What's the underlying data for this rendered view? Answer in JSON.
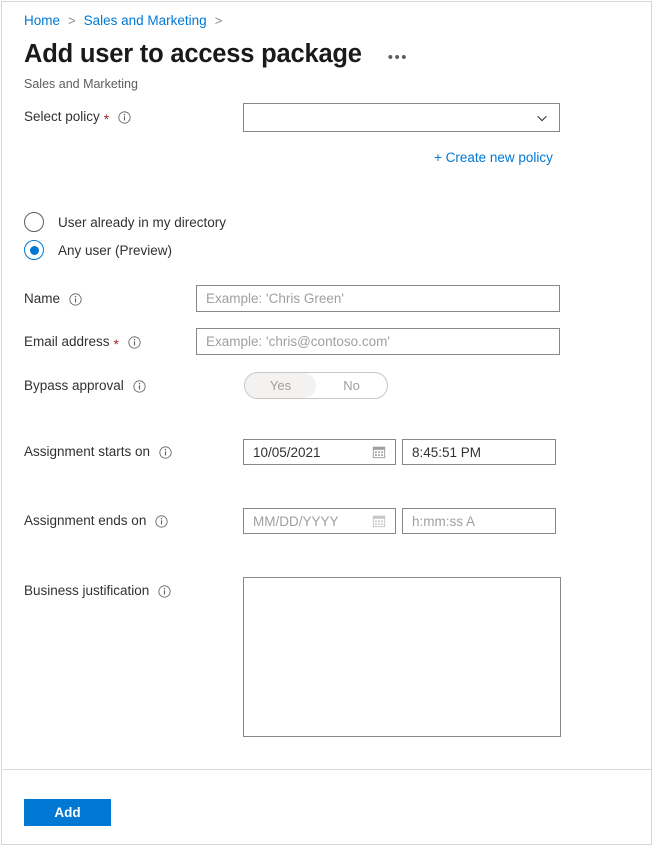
{
  "breadcrumb": {
    "items": [
      {
        "label": "Home"
      },
      {
        "label": "Sales and Marketing"
      }
    ],
    "separator": ">"
  },
  "header": {
    "title": "Add user to access package",
    "subtitle": "Sales and Marketing",
    "more_menu": "•••"
  },
  "form": {
    "policy": {
      "label": "Select policy",
      "required_marker": "*",
      "value": "",
      "create_link": "+ Create new policy"
    },
    "user_type": {
      "options": [
        {
          "label": "User already in my directory",
          "selected": false
        },
        {
          "label": "Any user (Preview)",
          "selected": true
        }
      ]
    },
    "name": {
      "label": "Name",
      "value": "",
      "placeholder": "Example: 'Chris Green'"
    },
    "email": {
      "label": "Email address",
      "required_marker": "*",
      "value": "",
      "placeholder": "Example: 'chris@contoso.com'"
    },
    "bypass_approval": {
      "label": "Bypass approval",
      "yes_label": "Yes",
      "no_label": "No",
      "selected": "Yes"
    },
    "assignment_starts": {
      "label": "Assignment starts on",
      "date_value": "10/05/2021",
      "date_placeholder": "MM/DD/YYYY",
      "time_value": "8:45:51 PM",
      "time_placeholder": "h:mm:ss A"
    },
    "assignment_ends": {
      "label": "Assignment ends on",
      "date_value": "",
      "date_placeholder": "MM/DD/YYYY",
      "time_value": "",
      "time_placeholder": "h:mm:ss A"
    },
    "business_justification": {
      "label": "Business justification",
      "value": ""
    }
  },
  "footer": {
    "add_label": "Add"
  },
  "colors": {
    "accent": "#0078d4",
    "link": "#0078d4",
    "required": "#a4262c",
    "border": "#8a8886",
    "panel_border": "#d6d6d6",
    "text": "#323130",
    "placeholder": "#a19f9d"
  }
}
